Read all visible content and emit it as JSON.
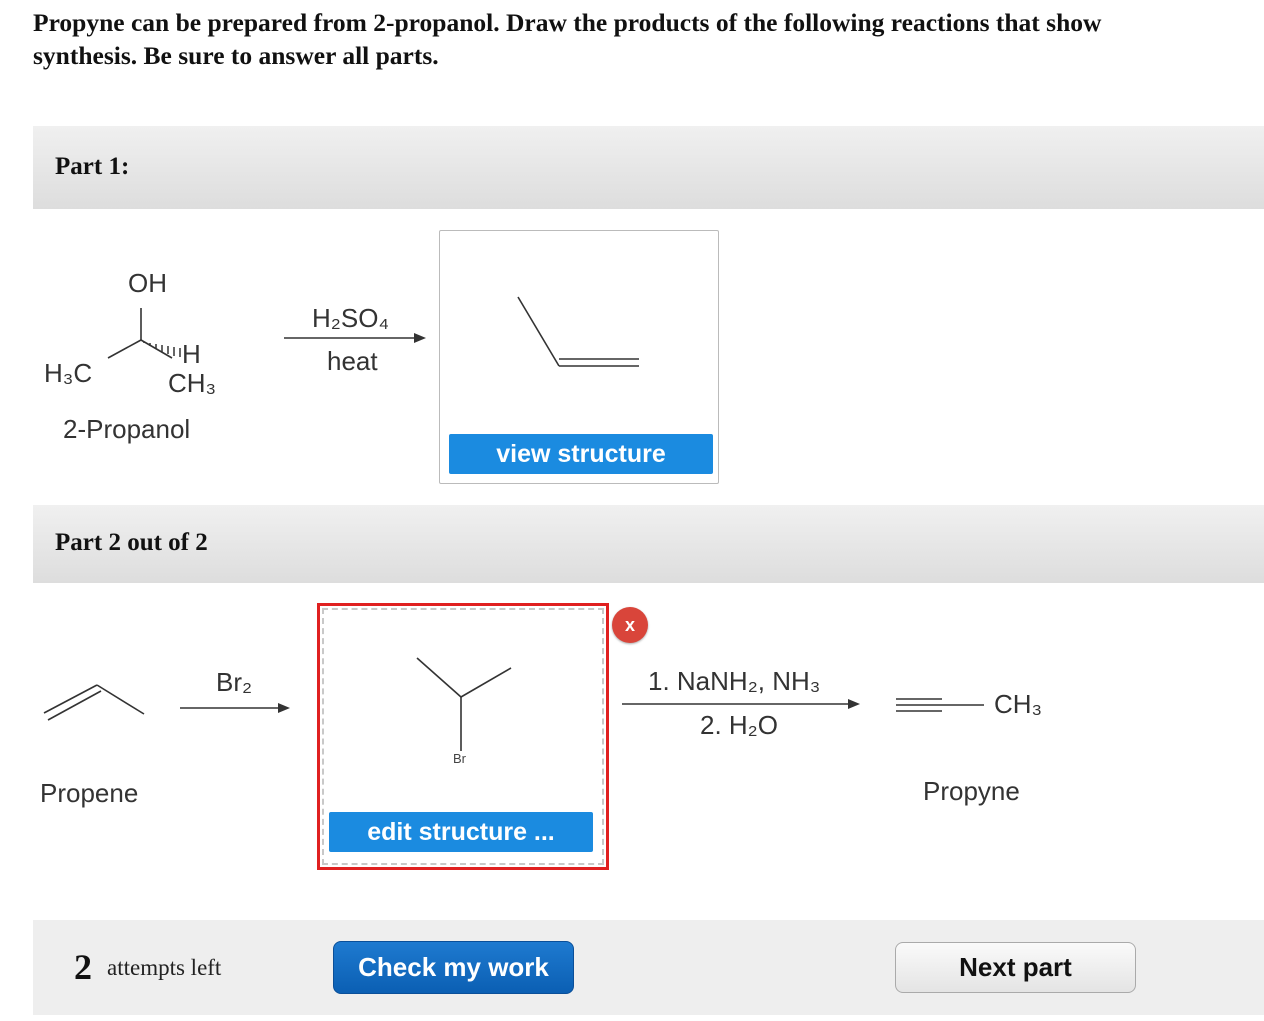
{
  "question": {
    "line1": "Propyne can be prepared from 2-propanol. Draw the products of the following reactions that show",
    "line2": "synthesis. Be sure to answer all parts."
  },
  "part1": {
    "header": "Part 1:",
    "reactant": {
      "oh": "OH",
      "h": "H",
      "h3c": "H₃C",
      "ch3": "CH₃",
      "name": "2-Propanol"
    },
    "reagent_top": "H₂SO₄",
    "reagent_bottom": "heat",
    "view_button": "view structure"
  },
  "part2": {
    "header": "Part 2 out of 2",
    "reactant_name": "Propene",
    "reagent1": "Br₂",
    "answer_atom_label": "Br",
    "edit_button": "edit structure ...",
    "error_icon_label": "x",
    "reagent2_top": "1. NaNH₂, NH₃",
    "reagent2_bottom": "2. H₂O",
    "product_group": "CH₃",
    "product_name": "Propyne"
  },
  "footer": {
    "attempts_count": "2",
    "attempts_text": "attempts left",
    "check_button": "Check my work",
    "next_button": "Next part"
  },
  "colors": {
    "accent_blue": "#1b8be0",
    "error_red": "#e02020",
    "error_icon": "#d9453a"
  }
}
